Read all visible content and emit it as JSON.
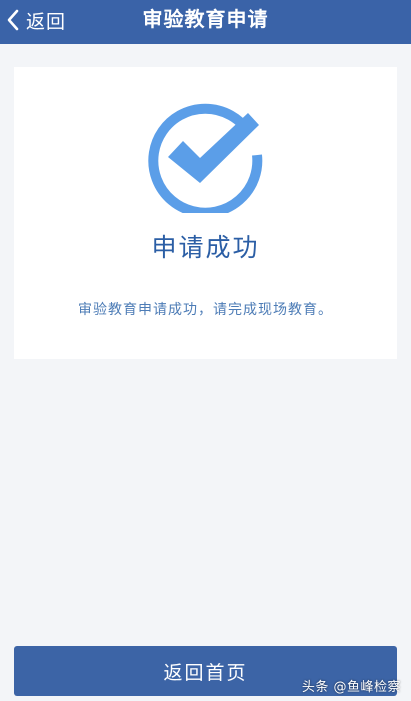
{
  "navbar": {
    "back_label": "返回",
    "title": "审验教育申请"
  },
  "result": {
    "icon": "check-circle-icon",
    "title": "申请成功",
    "message": "审验教育申请成功，请完成现场教育。"
  },
  "footer": {
    "home_button_label": "返回首页"
  },
  "watermark": "头条 @鱼峰检察",
  "colors": {
    "navbar_bg": "#3a63a8",
    "accent_blue": "#5b9ee8",
    "title_text": "#2b5ea5",
    "button_bg": "#3c64a6",
    "page_bg": "#f3f5f8"
  }
}
